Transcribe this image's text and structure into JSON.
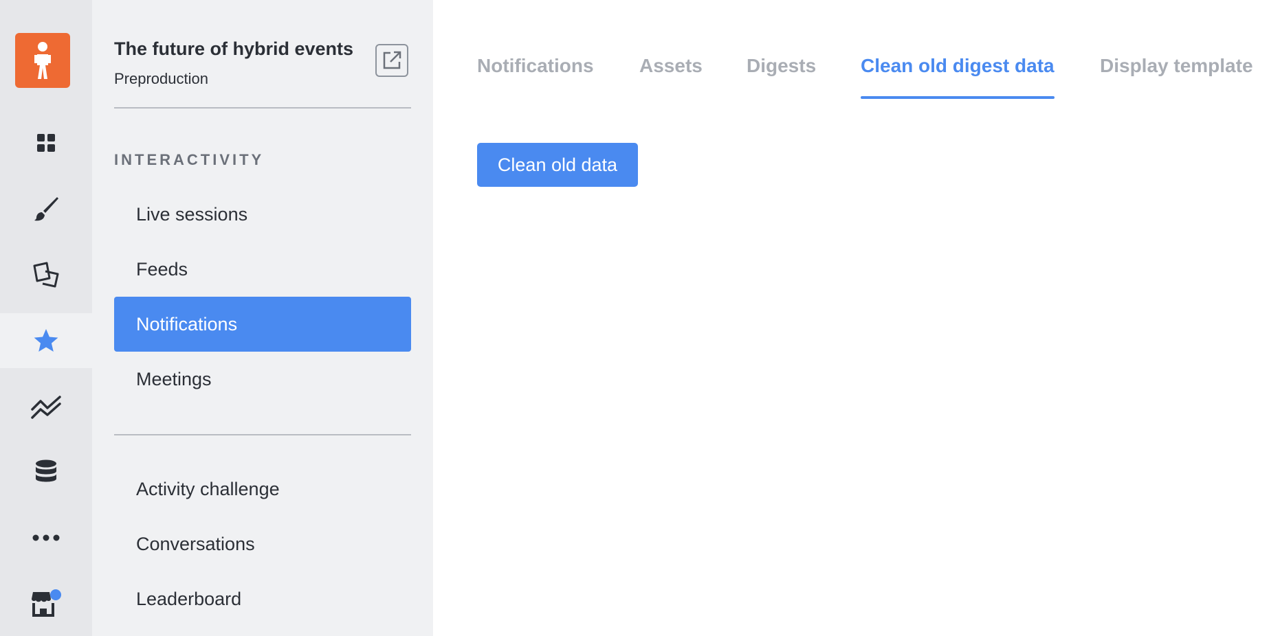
{
  "colors": {
    "accent": "#4a8af0",
    "brand": "#ee6a33",
    "notification_dot": "#4a8af0"
  },
  "rail": {
    "logo_icon": "person-logo-icon",
    "items": [
      {
        "icon": "dashboard-grid-icon"
      },
      {
        "icon": "paintbrush-icon"
      },
      {
        "icon": "pages-icon"
      },
      {
        "icon": "star-icon",
        "active": true
      },
      {
        "icon": "analytics-chart-icon"
      },
      {
        "icon": "database-icon"
      },
      {
        "icon": "more-dots-icon"
      },
      {
        "icon": "marketplace-store-icon",
        "badge": true
      }
    ]
  },
  "event": {
    "title": "The future of hybrid events",
    "subtitle": "Preproduction",
    "open_external_icon": "external-link-icon"
  },
  "sidebar": {
    "section_label": "INTERACTIVITY",
    "items": [
      {
        "label": "Live sessions"
      },
      {
        "label": "Feeds"
      },
      {
        "label": "Notifications",
        "active": true
      },
      {
        "label": "Meetings"
      }
    ],
    "more_items": [
      {
        "label": "Activity challenge"
      },
      {
        "label": "Conversations"
      },
      {
        "label": "Leaderboard"
      }
    ]
  },
  "tabs": [
    {
      "label": "Notifications"
    },
    {
      "label": "Assets"
    },
    {
      "label": "Digests"
    },
    {
      "label": "Clean old digest data",
      "active": true
    },
    {
      "label": "Display template"
    }
  ],
  "main": {
    "clean_button_label": "Clean old data"
  }
}
